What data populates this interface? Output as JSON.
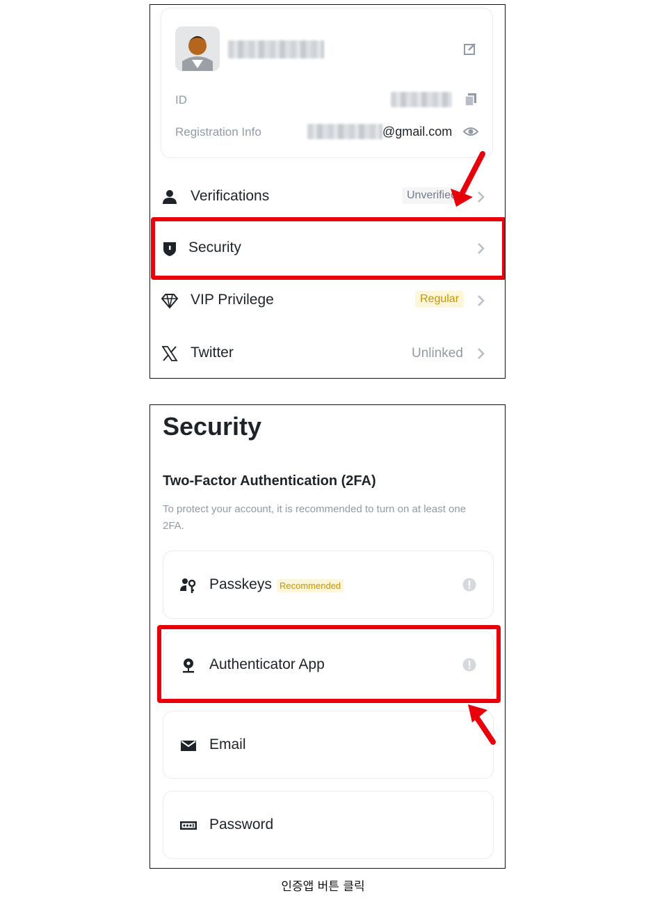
{
  "profile": {
    "id_label": "ID",
    "registration_label": "Registration Info",
    "email_suffix": "@gmail.com"
  },
  "menu": [
    {
      "label": "Verifications",
      "status": "Unverified",
      "icon": "person-icon"
    },
    {
      "label": "Security",
      "status": "",
      "icon": "shield-icon"
    },
    {
      "label": "VIP Privilege",
      "status": "Regular",
      "icon": "diamond-icon"
    },
    {
      "label": "Twitter",
      "status": "Unlinked",
      "icon": "x-logo-icon"
    }
  ],
  "security": {
    "title": "Security",
    "subtitle": "Two-Factor Authentication (2FA)",
    "description": "To protect your account, it is recommended to turn on at least one 2FA.",
    "options": [
      {
        "label": "Passkeys",
        "badge": "Recommended",
        "icon": "passkey-icon"
      },
      {
        "label": "Authenticator App",
        "icon": "authenticator-icon"
      },
      {
        "label": "Email",
        "icon": "envelope-icon"
      },
      {
        "label": "Password",
        "icon": "password-icon"
      }
    ]
  },
  "caption": "인증앱 버튼 클릭",
  "colors": {
    "highlight": "#e8000b",
    "badge_yellow": "#c99400",
    "text": "#1e2329",
    "muted": "#929aa5"
  }
}
